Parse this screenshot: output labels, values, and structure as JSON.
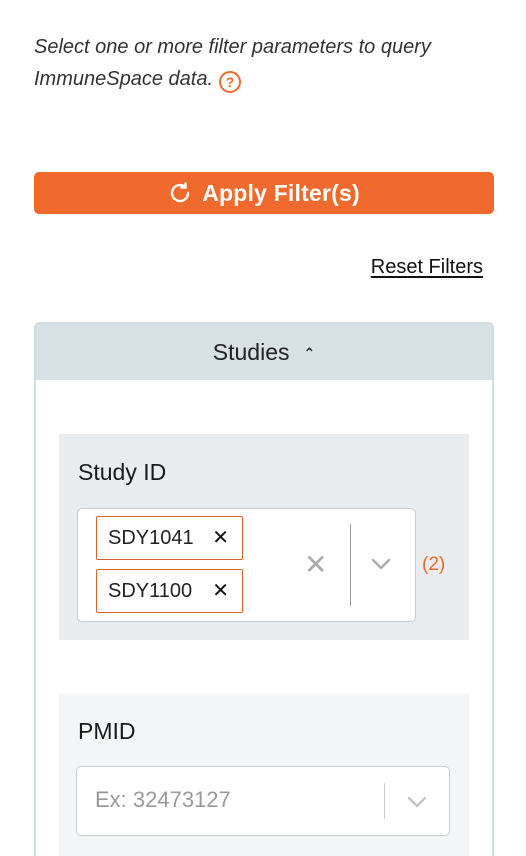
{
  "intro": {
    "text": "Select one or more filter parameters to query ImmuneSpace data.",
    "help_icon": "question-circle-icon"
  },
  "apply_button": {
    "label": "Apply Filter(s)",
    "icon": "refresh-icon"
  },
  "reset_link": {
    "label": "Reset Filters"
  },
  "panel": {
    "title": "Studies",
    "expanded": true,
    "sections": {
      "study_id": {
        "label": "Study ID",
        "selected": [
          "SDY1041",
          "SDY1100"
        ],
        "count": "(2)"
      },
      "pmid": {
        "label": "PMID",
        "placeholder": "Ex: 32473127"
      }
    }
  },
  "colors": {
    "accent": "#ef6a2c",
    "panel_header": "#d7e1e6",
    "section_bg": "#e9edef"
  }
}
